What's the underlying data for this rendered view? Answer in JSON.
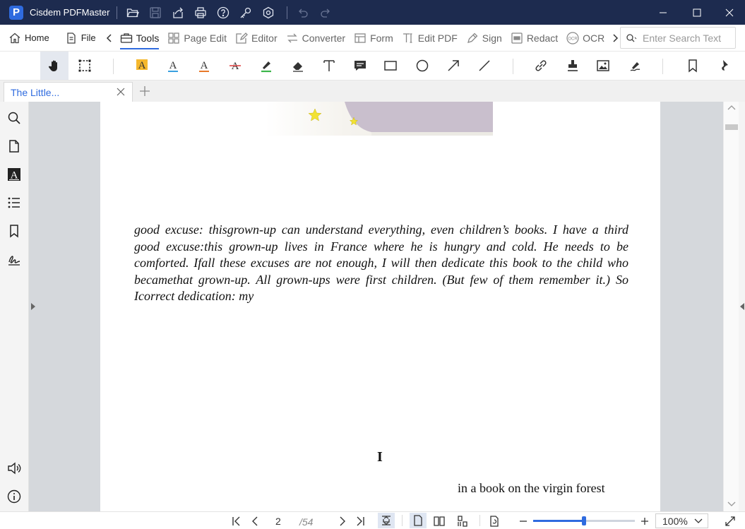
{
  "app": {
    "title": "Cisdem PDFMaster",
    "logo_letter": "P",
    "accent_color": "#2f6bdf",
    "titlebar_color": "#1d2b4f"
  },
  "menubar": {
    "home_label": "Home",
    "file_label": "File",
    "items": [
      {
        "label": "Tools",
        "icon": "toolbox-icon"
      },
      {
        "label": "Page Edit",
        "icon": "grid-icon"
      },
      {
        "label": "Editor",
        "icon": "edit-icon"
      },
      {
        "label": "Converter",
        "icon": "convert-icon"
      },
      {
        "label": "Form",
        "icon": "form-icon"
      },
      {
        "label": "Edit PDF",
        "icon": "text-cursor-icon"
      },
      {
        "label": "Sign",
        "icon": "pen-icon"
      },
      {
        "label": "Redact",
        "icon": "redact-icon"
      },
      {
        "label": "OCR",
        "icon": "ocr-icon"
      }
    ],
    "active_item": "Tools",
    "ocr_badge": "OCR",
    "search_placeholder": "Enter Search Text"
  },
  "tabs": {
    "active_tab_label": "The Little..."
  },
  "document": {
    "paragraph": "good excuse: thisgrown-up can understand everything, even children’s books. I have a third good excuse:this grown-up lives in France where he is hungry and cold. He needs to be comforted. Ifall these excuses are not enough, I will then dedicate this book to the child who becamethat grown-up. All grown-ups were first children. (But few of them remember it.) So Icorrect dedication: my",
    "chapter_number": "I",
    "tail_text": "in a book on the virgin forest"
  },
  "statusbar": {
    "current_page": "2",
    "total_pages": "/54",
    "zoom_label": "100%",
    "zoom_level": 0.5
  }
}
